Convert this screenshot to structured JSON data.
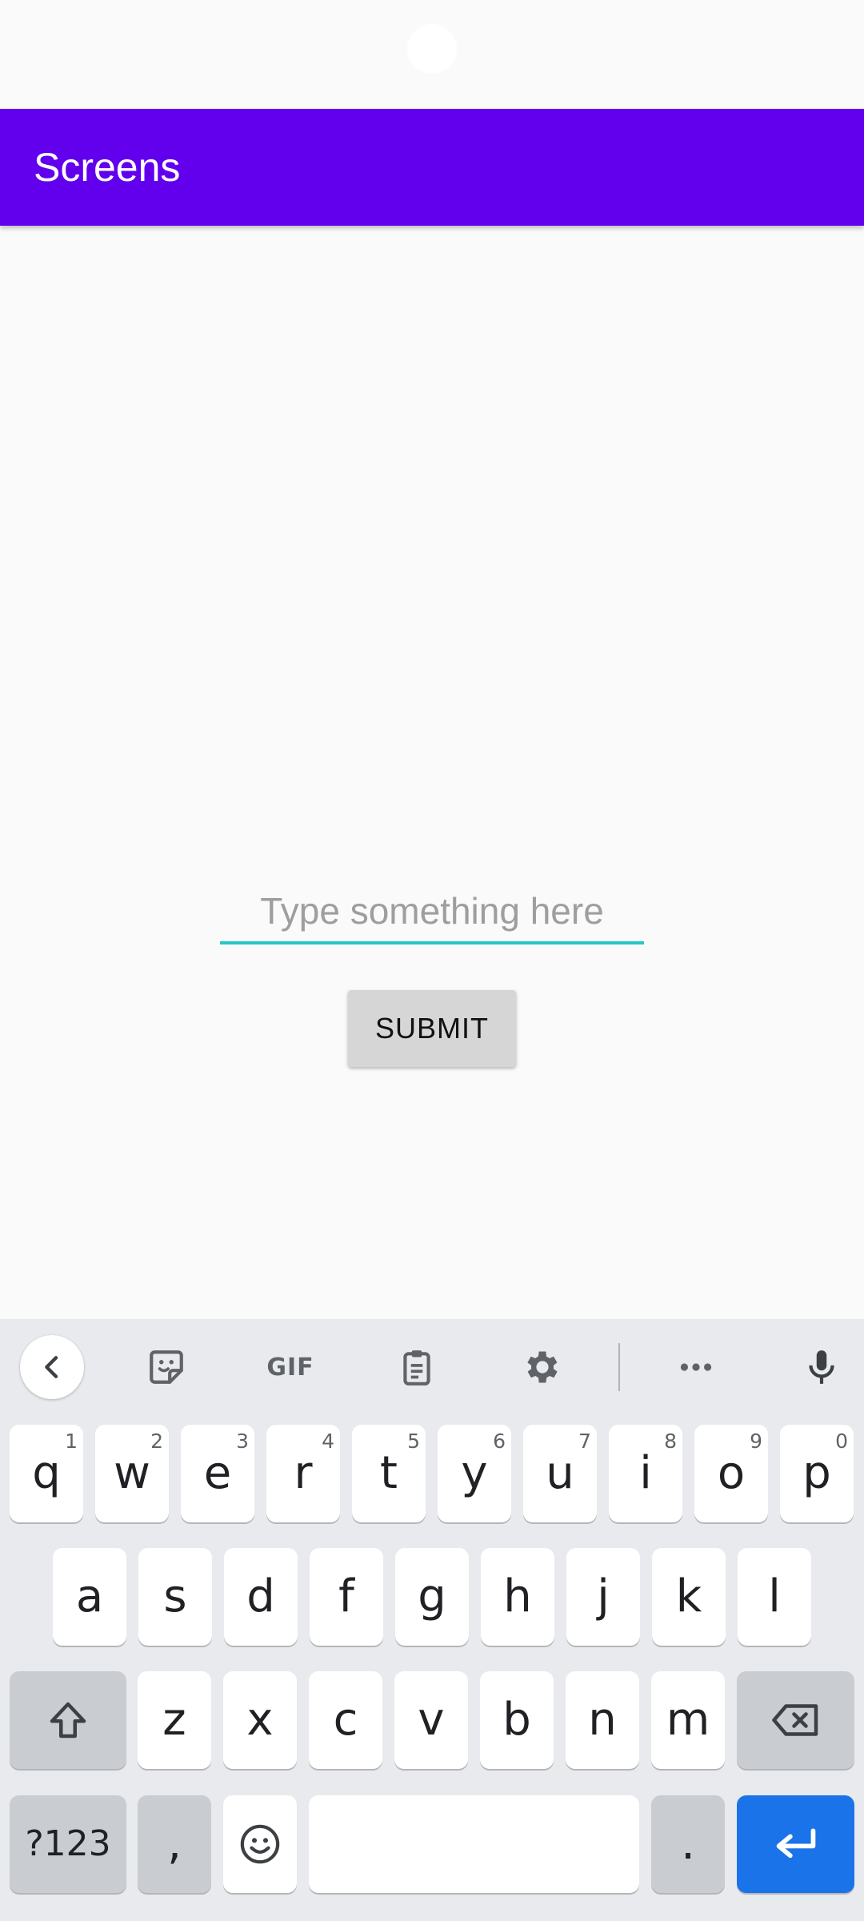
{
  "app": {
    "title": "Screens"
  },
  "form": {
    "input_placeholder": "Type something here",
    "input_value": "",
    "submit_label": "SUBMIT"
  },
  "colors": {
    "app_bar": "#6200ee",
    "input_underline": "#26c6c6",
    "keyboard_bg": "#e8eaed",
    "enter_key": "#1a73e8"
  },
  "keyboard": {
    "toolbar": [
      "back-icon",
      "sticker-icon",
      "GIF",
      "clipboard-icon",
      "gear-icon",
      "more-icon",
      "mic-icon"
    ],
    "gif_label": "GIF",
    "row1": [
      {
        "k": "q",
        "h": "1"
      },
      {
        "k": "w",
        "h": "2"
      },
      {
        "k": "e",
        "h": "3"
      },
      {
        "k": "r",
        "h": "4"
      },
      {
        "k": "t",
        "h": "5"
      },
      {
        "k": "y",
        "h": "6"
      },
      {
        "k": "u",
        "h": "7"
      },
      {
        "k": "i",
        "h": "8"
      },
      {
        "k": "o",
        "h": "9"
      },
      {
        "k": "p",
        "h": "0"
      }
    ],
    "row2": [
      "a",
      "s",
      "d",
      "f",
      "g",
      "h",
      "j",
      "k",
      "l"
    ],
    "row3": [
      "z",
      "x",
      "c",
      "v",
      "b",
      "n",
      "m"
    ],
    "symbols_label": "?123",
    "comma_label": ",",
    "period_label": "."
  }
}
